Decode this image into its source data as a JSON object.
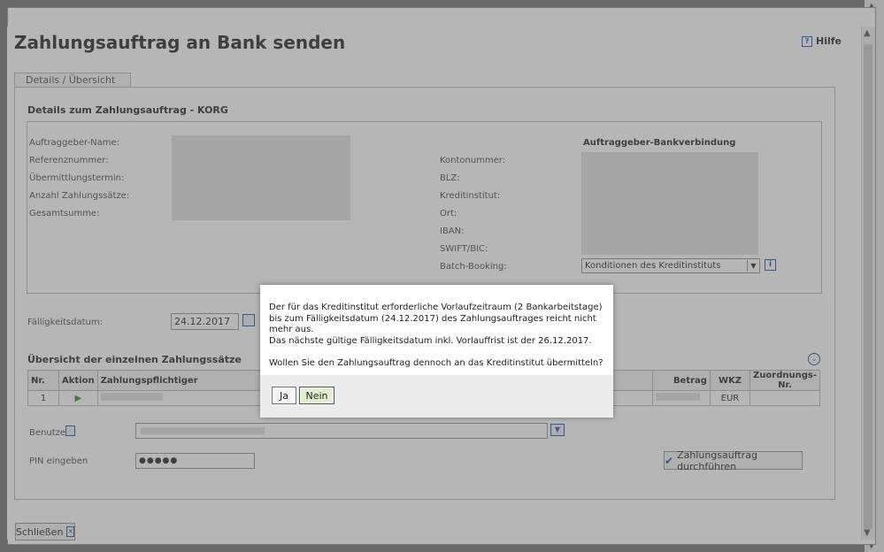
{
  "title": "Zahlungsauftrag an Bank senden",
  "help_label": "Hilfe",
  "tab_label": "Details / Übersicht",
  "section_details": "Details zum Zahlungsauftrag - KORG",
  "left_labels": [
    "Auftraggeber-Name:",
    "Referenznummer:",
    "Übermittlungstermin:",
    "Anzahl Zahlungssätze:",
    "Gesamtsumme:"
  ],
  "bank_header": "Auftraggeber-Bankverbindung",
  "right_labels": [
    "Kontonummer:",
    "BLZ:",
    "Kreditinstitut:",
    "Ort:",
    "IBAN:",
    "SWIFT/BIC:",
    "Batch-Booking:"
  ],
  "batch_booking_value": "Konditionen des Kreditinstituts",
  "due_date_label": "Fälligkeitsdatum:",
  "due_date_value": "24.12.2017",
  "section_overview": "Übersicht der einzelnen Zahlungssätze",
  "table": {
    "headers": [
      "Nr.",
      "Aktion",
      "Zahlungspflichtiger",
      "Betrag",
      "WKZ",
      "Zuordnungs-Nr."
    ],
    "row": {
      "nr": "1",
      "wkz": "EUR"
    }
  },
  "user_label": "Benutzer",
  "pin_label": "PIN eingeben",
  "pin_value": "●●●●●",
  "execute_label": "Zahlungsauftrag durchführen",
  "close_label": "Schließen",
  "modal": {
    "text1": "Der für das Kreditinstitut erforderliche Vorlaufzeitraum (2 Bankarbeitstage) bis zum Fälligkeitsdatum (24.12.2017) des Zahlungsauftrages reicht nicht mehr aus.",
    "text2": "Das nächste gültige Fälligkeitsdatum inkl. Vorlauffrist ist der 26.12.2017.",
    "text3": "Wollen Sie den Zahlungsauftrag dennoch an das Kreditinstitut übermitteln?",
    "yes_label": "Ja",
    "no_label": "Nein"
  },
  "colors": {
    "accent": "#2a5ea8",
    "no_button_bg": "#dff1cf",
    "overlay": "#7d7d7d"
  }
}
